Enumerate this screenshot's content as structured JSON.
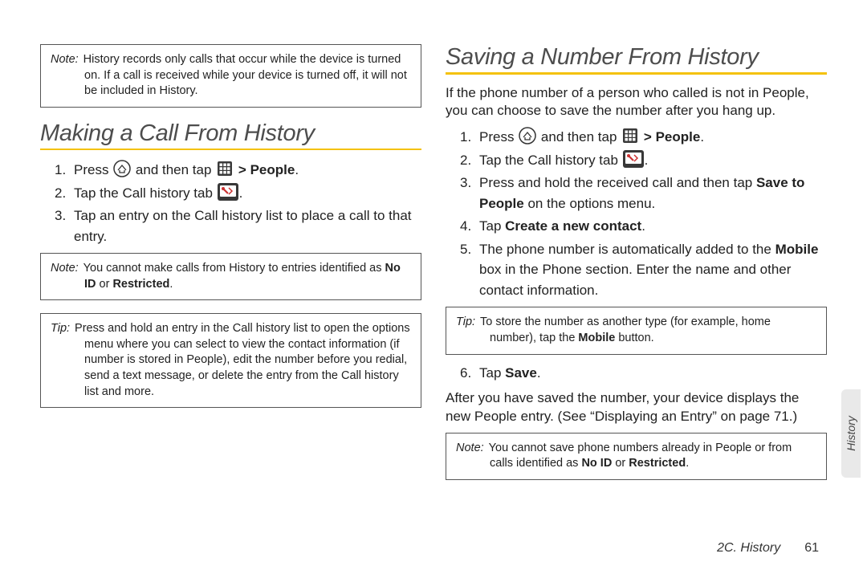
{
  "left": {
    "topnote": {
      "label": "Note:",
      "text": "History records only calls that occur while the device is turned on. If a call is received while your device is turned off, it will not be included in History."
    },
    "heading": "Making a Call From History",
    "steps": {
      "s1_1": "Press ",
      "s1_2": " and then tap ",
      "s1_3": "People",
      "s1_4": ".",
      "s2": "Tap the Call history tab ",
      "s2_4": ".",
      "s3": "Tap an entry on the Call history list to place a call to that entry."
    },
    "note2": {
      "label": "Note:",
      "t1": "You cannot make calls from History to entries identified as ",
      "b1": "No ID",
      "t2": " or ",
      "b2": "Restricted",
      "t3": "."
    },
    "tip1": {
      "label": "Tip:",
      "text": "Press and hold an entry in the Call history list to open the options menu where you can select to view the contact information (if number is stored in People), edit the number before you redial, send a text message, or delete the entry from the Call history list and more."
    }
  },
  "right": {
    "heading": "Saving a Number From History",
    "intro": "If the phone number of a person who called is not in People, you can choose to save the number after you hang up.",
    "steps": {
      "s1_1": "Press ",
      "s1_2": " and then tap ",
      "s1_3": "People",
      "s1_4": ".",
      "s2": "Tap the Call history tab ",
      "s2_4": ".",
      "s3_1": "Press and hold the received call and then tap ",
      "s3_b": "Save to People",
      "s3_2": " on the options menu.",
      "s4_1": "Tap ",
      "s4_b": "Create a new contact",
      "s4_2": ".",
      "s5_1": "The phone number is automatically added to the ",
      "s5_b": "Mobile",
      "s5_2": " box in the Phone section. Enter the name and other contact information.",
      "s6_1": "Tap ",
      "s6_b": "Save",
      "s6_2": "."
    },
    "tip": {
      "label": "Tip:",
      "t1": "To store the number as another type (for example, home number), tap the ",
      "b1": "Mobile",
      "t2": " button."
    },
    "after": "After you have saved the number, your device displays the new People entry. (See “Displaying an Entry” on page 71.)",
    "note2": {
      "label": "Note:",
      "t1": "You cannot save phone numbers already in People or from calls identified as ",
      "b1": "No ID",
      "t2": " or ",
      "b2": "Restricted",
      "t3": "."
    }
  },
  "footer": {
    "section": "2C. History",
    "page": "61"
  },
  "sidetab": "History",
  "gt": ">"
}
